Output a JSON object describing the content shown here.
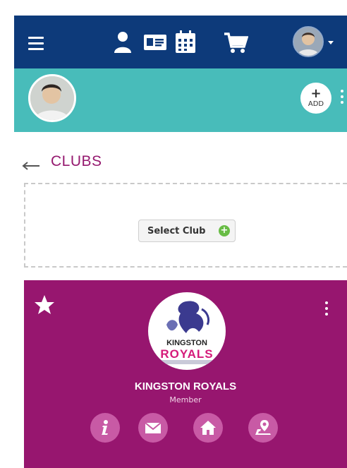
{
  "topbar": {
    "menu_icon": "hamburger-icon",
    "icons": [
      "user-icon",
      "id-card-icon",
      "calendar-icon",
      "cart-icon"
    ],
    "avatar": "avatar",
    "background": "#0d3a7a"
  },
  "profile_bar": {
    "add_label": "ADD",
    "background": "#48bcba"
  },
  "clubs": {
    "title": "CLUBS",
    "select_button_label": "Select Club",
    "title_color": "#95196f"
  },
  "club_card": {
    "logo_line1": "KINGSTON",
    "logo_line2": "ROYALS",
    "name": "KINGSTON ROYALS",
    "role": "Member",
    "background": "#97166f",
    "actions": [
      "info-icon",
      "mail-icon",
      "home-icon",
      "map-icon"
    ]
  }
}
